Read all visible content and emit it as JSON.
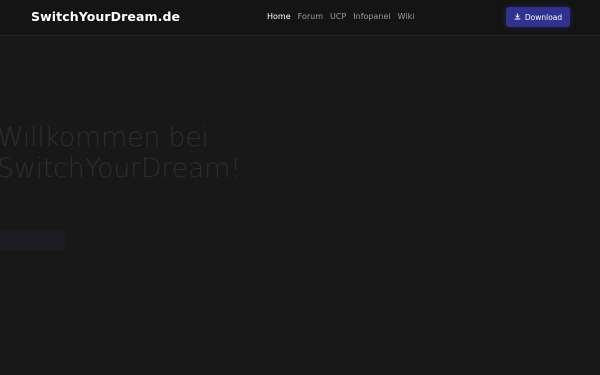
{
  "header": {
    "brand": "SwitchYourDream.de",
    "nav": [
      {
        "label": "Home",
        "active": true
      },
      {
        "label": "Forum",
        "active": false
      },
      {
        "label": "UCP",
        "active": false
      },
      {
        "label": "Infopanel",
        "active": false
      },
      {
        "label": "Wiki",
        "active": false
      }
    ],
    "download_label": "Download",
    "download_icon": "download-icon"
  },
  "hero": {
    "title_line1": "Willkommen bei",
    "title_line2": "SwitchYourDream!",
    "text": "",
    "cta_label": ""
  },
  "colors": {
    "background": "#181818",
    "header_bg": "#141414",
    "accent": "#31318f"
  }
}
